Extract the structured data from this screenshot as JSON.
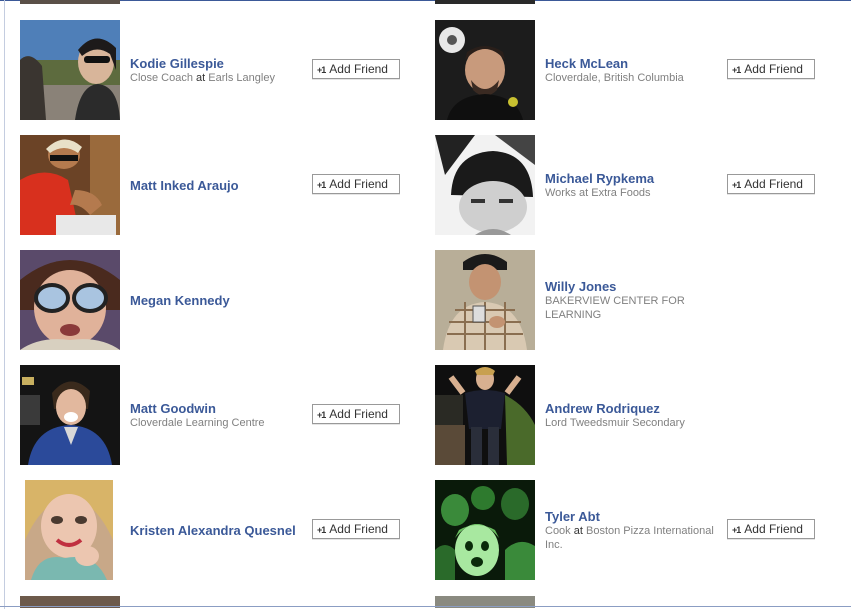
{
  "friends": [
    {
      "name": "Kodie Gillespie",
      "sub_pre": "Close Coach",
      "sub_at": "at",
      "sub_post": "Earls Langley",
      "button": "Add Friend"
    },
    {
      "name": "Heck McLean",
      "sub": "Cloverdale, British Columbia",
      "button": "Add Friend"
    },
    {
      "name": "Matt Inked Araujo",
      "button": "Add Friend"
    },
    {
      "name": "Michael Rypkema",
      "sub": "Works at Extra Foods",
      "button": "Add Friend"
    },
    {
      "name": "Megan Kennedy"
    },
    {
      "name": "Willy Jones",
      "sub": "BAKERVIEW CENTER FOR LEARNING"
    },
    {
      "name": "Matt Goodwin",
      "sub": "Cloverdale Learning Centre",
      "button": "Add Friend"
    },
    {
      "name": "Andrew Rodriquez",
      "sub": "Lord Tweedsmuir Secondary"
    },
    {
      "name": "Kristen Alexandra Quesnel",
      "button": "Add Friend"
    },
    {
      "name": "Tyler Abt",
      "sub_pre": "Cook",
      "sub_at": "at",
      "sub_post": "Boston Pizza International Inc.",
      "button": "Add Friend"
    }
  ],
  "icons": {
    "add_friend": "+1 add-friend-icon"
  }
}
